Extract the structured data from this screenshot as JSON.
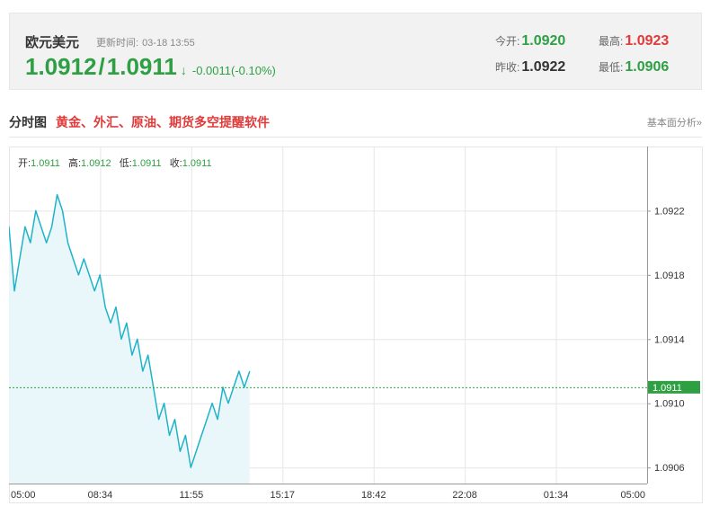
{
  "quote": {
    "name": "欧元美元",
    "update_label": "更新时间:",
    "update_time": "03-18 13:55",
    "bid": "1.0912",
    "separator": "/",
    "ask": "1.0911",
    "arrow": "↓",
    "change": "-0.0011(-0.10%)",
    "open_label": "今开:",
    "open": "1.0920",
    "high_label": "最高:",
    "high": "1.0923",
    "prev_close_label": "昨收:",
    "prev_close": "1.0922",
    "low_label": "最低:",
    "low": "1.0906"
  },
  "section": {
    "title": "分时图",
    "promo_link": "黄金、外汇、原油、期货多空提醒软件",
    "fundamental_link": "基本面分析»"
  },
  "ohlc": {
    "open_label": "开:",
    "open": "1.0911",
    "high_label": "高:",
    "high": "1.0912",
    "low_label": "低:",
    "low": "1.0911",
    "close_label": "收:",
    "close": "1.0911"
  },
  "colors": {
    "line": "#1fb3c9",
    "fill": "#eaf7fa",
    "up": "#e03a3a",
    "down": "#2ea043",
    "grid": "#e6e6e6",
    "current_marker": "#2ea043"
  },
  "chart_data": {
    "type": "line",
    "x_ticks": [
      "05:00",
      "08:34",
      "11:55",
      "15:17",
      "18:42",
      "22:08",
      "01:34",
      "05:00"
    ],
    "y_ticks": [
      1.0906,
      1.091,
      1.0914,
      1.0918,
      1.0922
    ],
    "y_tick_labels": [
      "1.0906",
      "1.0910",
      "1.0914",
      "1.0918",
      "1.0922"
    ],
    "ylim": [
      1.0905,
      1.0926
    ],
    "current_value": 1.0911,
    "current_label": "1.0911",
    "grid": true,
    "series": [
      {
        "values": [
          1.0921,
          1.0917,
          1.0919,
          1.0921,
          1.092,
          1.0922,
          1.0921,
          1.092,
          1.0921,
          1.0923,
          1.0922,
          1.092,
          1.0919,
          1.0918,
          1.0919,
          1.0918,
          1.0917,
          1.0918,
          1.0916,
          1.0915,
          1.0916,
          1.0914,
          1.0915,
          1.0913,
          1.0914,
          1.0912,
          1.0913,
          1.0911,
          1.0909,
          1.091,
          1.0908,
          1.0909,
          1.0907,
          1.0908,
          1.0906,
          1.0907,
          1.0908,
          1.0909,
          1.091,
          1.0909,
          1.0911,
          1.091,
          1.0911,
          1.0912,
          1.0911,
          1.0912
        ]
      }
    ]
  }
}
